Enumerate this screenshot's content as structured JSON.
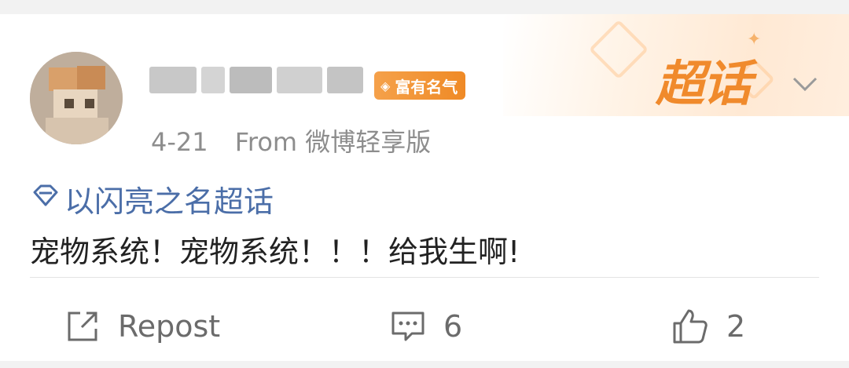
{
  "post": {
    "date": "4-21",
    "source": "From 微博轻享版",
    "badge_label": "富有名气",
    "supertopic_label": "超话",
    "topic": "以闪亮之名超话",
    "text": "宠物系统！宠物系统！！！给我生啊!"
  },
  "actions": {
    "repost_label": "Repost",
    "comment_count": "6",
    "like_count": "2"
  },
  "icons": {
    "repost": "repost-icon",
    "comment": "comment-icon",
    "like": "thumbs-up-icon",
    "chevron": "chevron-down-icon",
    "topic": "diamond-icon",
    "badge": "badge-icon"
  },
  "colors": {
    "accent": "#f08a2c",
    "link": "#4b6ea8",
    "text": "#222222",
    "muted": "#8d8d8d"
  }
}
